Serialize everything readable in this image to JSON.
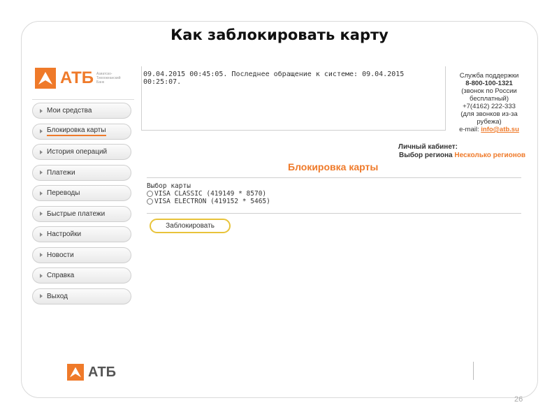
{
  "slide": {
    "title": "Как заблокировать карту",
    "page_number": "26"
  },
  "brand": {
    "name": "АТБ",
    "subtitle": "Азиатско-Тихоокеанский Банк",
    "accent_color": "#ef7a2a",
    "logo_icon": "atb-chevron-icon"
  },
  "sidebar": {
    "items": [
      {
        "label": "Мои средства"
      },
      {
        "label": "Блокировка карты"
      },
      {
        "label": "История операций"
      },
      {
        "label": "Платежи"
      },
      {
        "label": "Переводы"
      },
      {
        "label": "Быстрые платежи"
      },
      {
        "label": "Настройки"
      },
      {
        "label": "Новости"
      },
      {
        "label": "Справка"
      },
      {
        "label": "Выход"
      }
    ]
  },
  "session_info": "09.04.2015 00:45:05. Последнее обращение к системе: 09.04.2015 00:25:07.",
  "support": {
    "title": "Служба поддержки",
    "phone1": "8-800-100-1321",
    "note1": "(звонок по России бесплатный)",
    "phone2": "+7(4162) 222-333",
    "note2": "(для звонков из-за рубежа)",
    "email_prefix": "e-mail:",
    "email": "info@atb.su"
  },
  "account": {
    "cabinet_label": "Личный кабинет:",
    "region_label": "Выбор региона",
    "region_value": "Несколько регионов"
  },
  "main": {
    "heading": "Блокировка карты",
    "card_select_label": "Выбор карты",
    "cards": [
      {
        "label": "VISA CLASSIC (419149 * 8570)"
      },
      {
        "label": "VISA ELECTRON (419152 * 5465)"
      }
    ],
    "block_button": "Заблокировать"
  }
}
